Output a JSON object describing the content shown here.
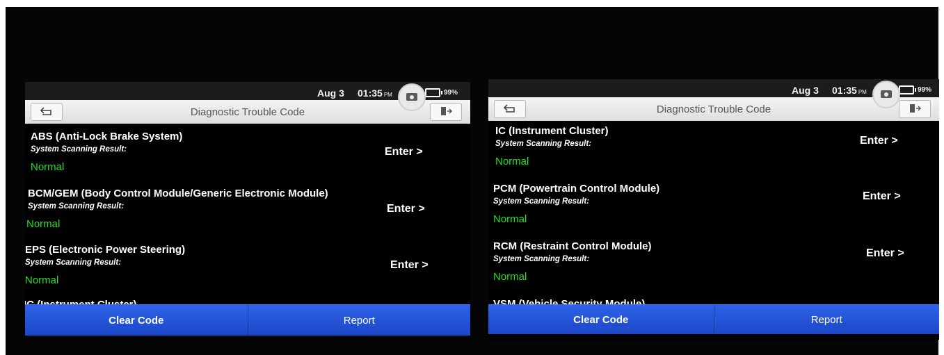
{
  "screens": [
    {
      "status": {
        "date": "Aug 3",
        "time": "01:35",
        "ampm": "PM",
        "battery": "99%"
      },
      "title": "Diagnostic Trouble Code",
      "modules": [
        {
          "name": "ABS (Anti-Lock Brake System)",
          "scan_label": "System Scanning Result:",
          "status": "Normal",
          "action": "Enter >"
        },
        {
          "name": "BCM/GEM (Body Control Module/Generic Electronic Module)",
          "scan_label": "System Scanning Result:",
          "status": "Normal",
          "action": "Enter >"
        },
        {
          "name": "EPS (Electronic Power Steering)",
          "scan_label": "System Scanning Result:",
          "status": "Normal",
          "action": "Enter >"
        }
      ],
      "partial_module": "IC (Instrument Cluster)",
      "buttons": {
        "clear": "Clear Code",
        "report": "Report"
      }
    },
    {
      "status": {
        "date": "Aug 3",
        "time": "01:35",
        "ampm": "PM",
        "battery": "99%"
      },
      "title": "Diagnostic Trouble Code",
      "modules": [
        {
          "name": "IC (Instrument Cluster)",
          "scan_label": "System Scanning Result:",
          "status": "Normal",
          "action": "Enter >"
        },
        {
          "name": "PCM (Powertrain Control Module)",
          "scan_label": "System Scanning Result:",
          "status": "Normal",
          "action": "Enter >"
        },
        {
          "name": "RCM (Restraint Control Module)",
          "scan_label": "System Scanning Result:",
          "status": "Normal",
          "action": "Enter >"
        }
      ],
      "partial_module": "VSM (Vehicle Security Module)",
      "buttons": {
        "clear": "Clear Code",
        "report": "Report"
      }
    }
  ],
  "icons": {
    "back": "back-arrow-icon",
    "exit": "exit-door-icon",
    "camera": "camera-icon"
  },
  "colors": {
    "normal_status": "#22e022",
    "bottom_bar": "#2450d8",
    "title_bar": "#e8e8e8"
  }
}
